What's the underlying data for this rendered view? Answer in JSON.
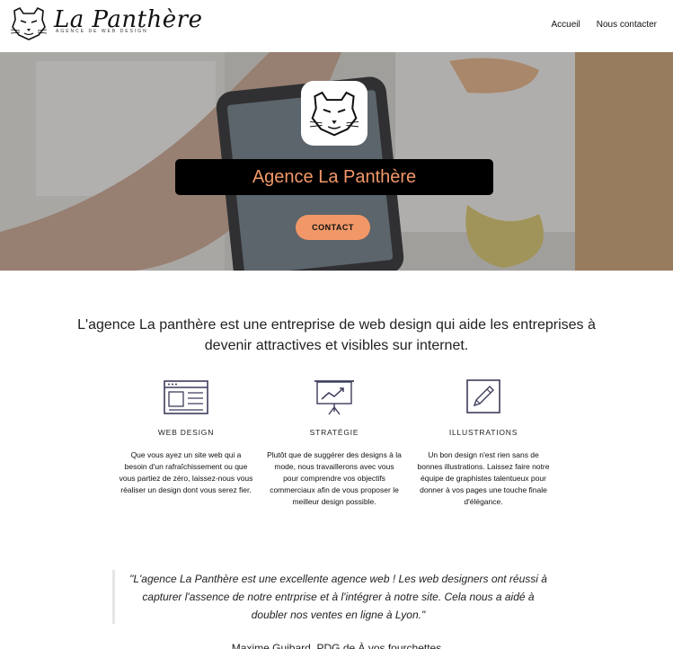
{
  "header": {
    "logo_title": "La Panthère",
    "logo_subtitle": "AGENCE DE WEB DESIGN",
    "nav": [
      {
        "label": "Accueil"
      },
      {
        "label": "Nous contacter"
      }
    ]
  },
  "hero": {
    "title": "Agence La Panthère",
    "button_label": "CONTACT"
  },
  "intro": {
    "text": "L'agence La panthère est une entreprise de web design qui aide les entreprises à devenir attractives et visibles sur internet."
  },
  "services": [
    {
      "icon": "browser-window-icon",
      "title": "WEB DESIGN",
      "description": "Que vous ayez un site web qui a besoin d'un rafraîchissement ou que vous partiez de zéro, laissez-nous vous réaliser un design dont vous serez fier."
    },
    {
      "icon": "presentation-board-icon",
      "title": "STRATÉGIE",
      "description": "Plutôt que de suggérer des designs à la mode, nous travaillerons avec vous pour comprendre vos objectifs commerciaux afin de vous proposer le meilleur design possible."
    },
    {
      "icon": "pencil-square-icon",
      "title": "ILLUSTRATIONS",
      "description": "Un bon design n'est rien sans de bonnes illustrations. Laissez faire notre équipe de graphistes talentueux pour donner à vos pages une touche finale d'élégance."
    }
  ],
  "testimonial": {
    "quote": "\"L'agence La Panthère est une excellente agence web ! Les web designers ont réussi à capturer l'assence de notre entrprise et à l'intégrer à notre site. Cela nous a aidé à doubler nos ventes en ligne à Lyon.\"",
    "author": "Maxime Guibard, PDG de À vos fourchettes"
  },
  "colors": {
    "accent": "#f29868",
    "hero_box": "#000000",
    "icon_stroke": "#3d3d5c"
  }
}
